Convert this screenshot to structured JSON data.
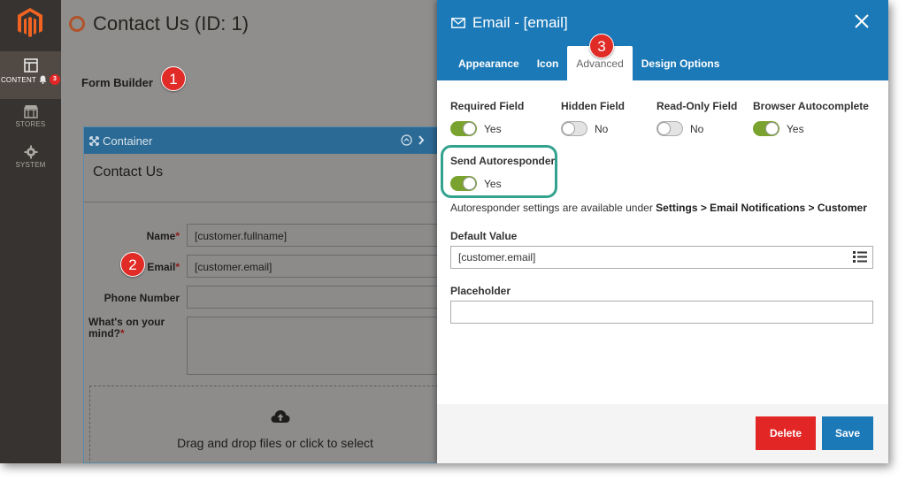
{
  "sidebar": {
    "items": [
      {
        "label": "CONTENT",
        "badge": "3",
        "active": true
      },
      {
        "label": "STORES"
      },
      {
        "label": "SYSTEM"
      }
    ]
  },
  "page": {
    "title": "Contact Us (ID: 1)",
    "builder_label": "Form Builder"
  },
  "container": {
    "header": "Container",
    "title": "Contact Us",
    "fields": [
      {
        "label": "Name",
        "required": "*",
        "value": "[customer.fullname]"
      },
      {
        "label": "Email",
        "required": "*",
        "value": "[customer.email]"
      },
      {
        "label": "Phone Number",
        "required": "",
        "value": ""
      },
      {
        "label": "What's on your mind?",
        "required": "*",
        "value": ""
      }
    ],
    "dropzone_text": "Drag and drop files or click to select"
  },
  "callouts": [
    "1",
    "2",
    "3"
  ],
  "modal": {
    "title": "Email - [email]",
    "tabs": [
      "Appearance",
      "Icon",
      "Advanced",
      "Design Options"
    ],
    "active_tab": "Advanced",
    "toggles": [
      {
        "label": "Required Field",
        "value": "Yes",
        "on": true
      },
      {
        "label": "Hidden Field",
        "value": "No",
        "on": false
      },
      {
        "label": "Read-Only Field",
        "value": "No",
        "on": false
      },
      {
        "label": "Browser Autocomplete",
        "value": "Yes",
        "on": true
      }
    ],
    "autoresponder": {
      "label": "Send Autoresponder",
      "value": "Yes",
      "on": true,
      "info_prefix": "Autoresponder settings are available under ",
      "info_path": "Settings > Email Notifications > Customer"
    },
    "default_value": {
      "label": "Default Value",
      "value": "[customer.email]"
    },
    "placeholder": {
      "label": "Placeholder",
      "value": ""
    },
    "buttons": {
      "delete": "Delete",
      "save": "Save"
    }
  },
  "colors": {
    "accent": "#1b79b8",
    "toggle_on": "#79a22e",
    "delete": "#e22626",
    "highlight_ring": "#33a28e"
  }
}
